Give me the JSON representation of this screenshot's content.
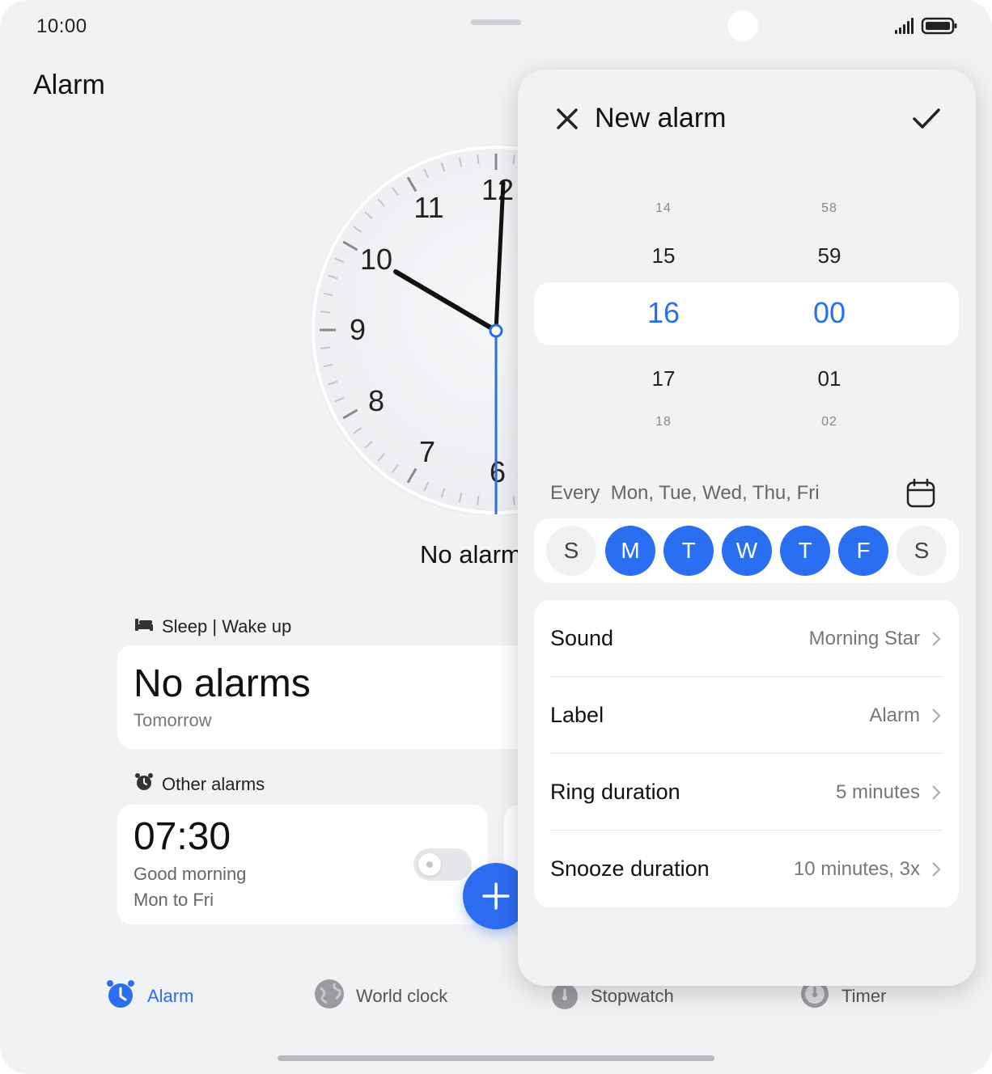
{
  "status_bar": {
    "time": "10:00"
  },
  "page": {
    "title": "Alarm"
  },
  "clock": {
    "numbers": [
      "11",
      "12",
      "10",
      "9",
      "8",
      "7",
      "6"
    ],
    "time_shown": "10:00"
  },
  "no_alarm_text": "No alarm",
  "sleep_section": {
    "label": "Sleep | Wake up",
    "main": "No alarms",
    "sub": "Tomorrow"
  },
  "other_section": {
    "label": "Other alarms"
  },
  "alarm_item": {
    "time": "07:30",
    "label": "Good morning",
    "repeat": "Mon to Fri",
    "enabled": false
  },
  "bottom_nav": {
    "items": [
      {
        "label": "Alarm",
        "active": true
      },
      {
        "label": "World clock",
        "active": false
      },
      {
        "label": "Stopwatch",
        "active": false
      },
      {
        "label": "Timer",
        "active": false
      }
    ]
  },
  "panel": {
    "title": "New alarm",
    "hours": [
      "14",
      "15",
      "16",
      "17",
      "18"
    ],
    "minutes": [
      "58",
      "59",
      "00",
      "01",
      "02"
    ],
    "repeat_prefix": "Every",
    "repeat_days": "Mon, Tue, Wed, Thu, Fri",
    "days": [
      {
        "letter": "S",
        "on": false
      },
      {
        "letter": "M",
        "on": true
      },
      {
        "letter": "T",
        "on": true
      },
      {
        "letter": "W",
        "on": true
      },
      {
        "letter": "T",
        "on": true
      },
      {
        "letter": "F",
        "on": true
      },
      {
        "letter": "S",
        "on": false
      }
    ],
    "settings": [
      {
        "label": "Sound",
        "value": "Morning Star"
      },
      {
        "label": "Label",
        "value": "Alarm"
      },
      {
        "label": "Ring duration",
        "value": "5 minutes"
      },
      {
        "label": "Snooze duration",
        "value": "10 minutes, 3x"
      }
    ]
  },
  "colors": {
    "accent": "#2a6ff2",
    "background": "#f1f2f4",
    "card": "#ffffff"
  }
}
